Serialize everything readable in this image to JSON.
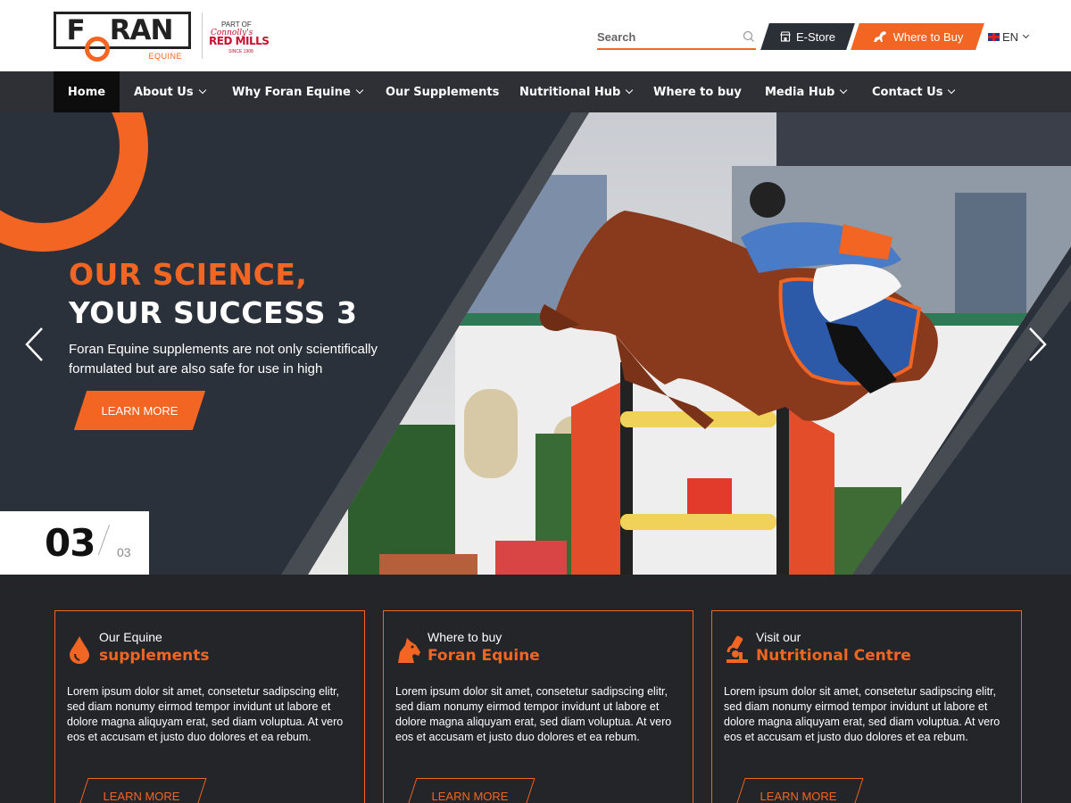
{
  "header": {
    "logo_text": "FORAN",
    "logo_sub": "EQUINE",
    "partner_part": "PART OF",
    "partner_script": "Connolly's",
    "partner_name": "RED MILLS",
    "partner_since": "SINCE 1908",
    "search_placeholder": "Search",
    "estore_label": "E-Store",
    "where_label": "Where to Buy",
    "lang_label": "EN"
  },
  "nav": {
    "items": [
      {
        "label": "Home"
      },
      {
        "label": "About Us"
      },
      {
        "label": "Why Foran Equine"
      },
      {
        "label": "Our Supplements"
      },
      {
        "label": "Nutritional Hub"
      },
      {
        "label": "Where to buy"
      },
      {
        "label": "Media Hub"
      },
      {
        "label": "Contact Us"
      }
    ]
  },
  "hero": {
    "title_line1": "OUR SCIENCE,",
    "title_line2": "YOUR SUCCESS 3",
    "text": "Foran Equine supplements are not only scientifically formulated but are also safe for use in high",
    "button_label": "LEARN MORE",
    "slide_current": "03",
    "slide_total": "03"
  },
  "cards": [
    {
      "small": "Our Equine",
      "big": "supplements",
      "icon": "droplet-icon",
      "text": "Lorem ipsum dolor sit amet, consetetur sadipscing elitr, sed diam nonumy eirmod tempor invidunt ut labore et dolore magna aliquyam erat, sed diam voluptua. At vero eos et accusam et justo duo dolores et ea rebum.",
      "button": "LEARN MORE"
    },
    {
      "small": "Where to buy",
      "big": "Foran Equine",
      "icon": "horse-head-icon",
      "text": "Lorem ipsum dolor sit amet, consetetur sadipscing elitr, sed diam nonumy eirmod tempor invidunt ut labore et dolore magna aliquyam erat, sed diam voluptua. At vero eos et accusam et justo duo dolores et ea rebum.",
      "button": "LEARN MORE"
    },
    {
      "small": "Visit our",
      "big": "Nutritional Centre",
      "icon": "microscope-icon",
      "text": "Lorem ipsum dolor sit amet, consetetur sadipscing elitr, sed diam nonumy eirmod tempor invidunt ut labore et dolore magna aliquyam erat, sed diam voluptua. At vero eos et accusam et justo duo dolores et ea rebum.",
      "button": "LEARN MORE"
    }
  ],
  "colors": {
    "accent": "#f26522",
    "dark": "#2b313a",
    "nav": "#2e3035",
    "section": "#232529"
  }
}
